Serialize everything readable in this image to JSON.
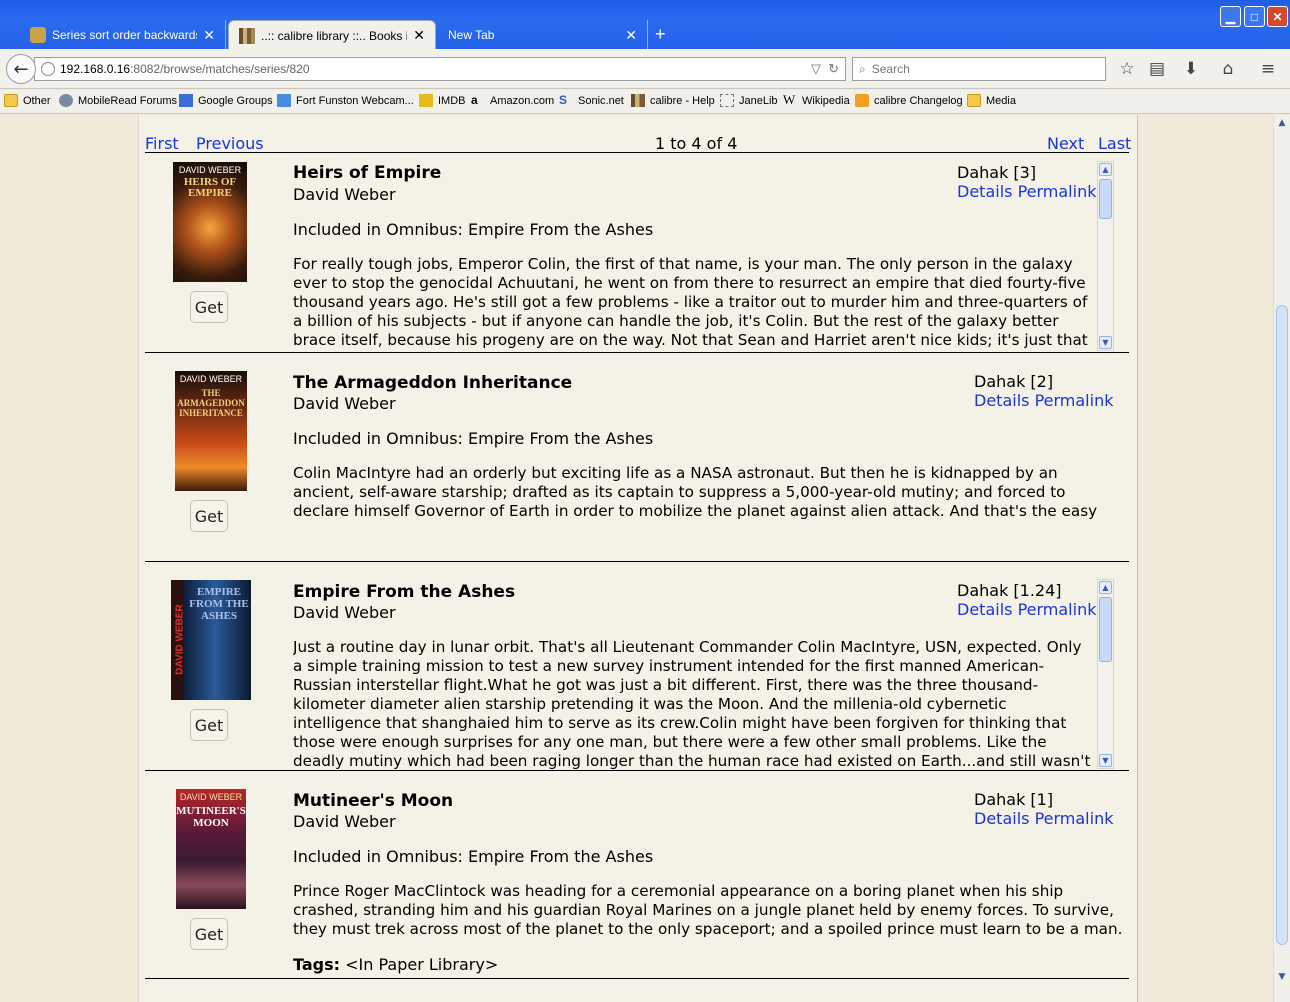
{
  "browser": {
    "tabs": [
      {
        "label": "Series sort order backwards v...",
        "active": false
      },
      {
        "label": "..:: calibre library ::.. Books i...",
        "active": true
      },
      {
        "label": "New Tab",
        "active": false
      }
    ],
    "new_tab_symbol": "+",
    "window_controls": {
      "minimize": "▁",
      "maximize": "□",
      "close": "✕"
    },
    "url_host": "192.168.0.16",
    "url_rest": ":8082/browse/matches/series/820",
    "search_placeholder": "Search",
    "toolbar_icons": [
      "back-icon",
      "reload-icon",
      "star-icon",
      "reading-list-icon",
      "download-icon",
      "home-icon",
      "menu-icon"
    ],
    "bookmarks": [
      {
        "label": "Other",
        "icon": "folder-icon"
      },
      {
        "label": "MobileRead Forums",
        "icon": "site-icon"
      },
      {
        "label": "Google Groups",
        "icon": "site-icon"
      },
      {
        "label": "Fort Funston Webcam...",
        "icon": "site-icon"
      },
      {
        "label": "IMDB",
        "icon": "imdb-icon"
      },
      {
        "label": "Amazon.com",
        "icon": "amazon-icon"
      },
      {
        "label": "Sonic.net",
        "icon": "site-icon"
      },
      {
        "label": "calibre - Help",
        "icon": "calibre-icon"
      },
      {
        "label": "JaneLib",
        "icon": "blank-icon"
      },
      {
        "label": "Wikipedia",
        "icon": "wikipedia-icon"
      },
      {
        "label": "calibre Changelog",
        "icon": "rss-icon"
      },
      {
        "label": "Media",
        "icon": "folder-icon"
      }
    ]
  },
  "pager": {
    "first": "First",
    "previous": "Previous",
    "range": "1 to 4 of 4",
    "next": "Next",
    "last": "Last"
  },
  "books": [
    {
      "title": "Heirs of Empire",
      "author": "David Weber",
      "omnibus": "Included in Omnibus: Empire From the Ashes",
      "series": "Dahak [3]",
      "details": "Details",
      "permalink": "Permalink",
      "get": "Get",
      "description": "For really tough jobs, Emperor Colin, the first of that name, is your man. The only person in the galaxy ever to stop the genocidal Achuutani, he went on from there to resurrect an empire that died fourty-five thousand years ago. He's still got a few problems - like a traitor out to murder him and three-quarters of a billion of his subjects - but if anyone can handle the job, it's Colin. But the rest of the galaxy better brace itself, because his progeny are on the way. Not that Sean and Harriet aren't nice kids; it's just that they've had a bad day.They're a long way from home, marooned with a",
      "cover": {
        "top_text": "DAVID WEBER",
        "title_text": "HEIRS OF EMPIRE"
      }
    },
    {
      "title": "The Armageddon Inheritance",
      "author": "David Weber",
      "omnibus": "Included in Omnibus: Empire From the Ashes",
      "series": "Dahak [2]",
      "details": "Details",
      "permalink": "Permalink",
      "get": "Get",
      "description": "Colin MacIntyre had an orderly but exciting life as a NASA astronaut. But then he is kidnapped by an ancient, self-aware starship; drafted as its captain to suppress a 5,000-year-old mutiny; and forced to declare himself Governor of Earth in order to mobilize the planet against alien attack. And that's the easy part. . . .",
      "cover": {
        "top_text": "DAVID WEBER",
        "title_text": "THE ARMAGEDDON INHERITANCE"
      }
    },
    {
      "title": "Empire From the Ashes",
      "author": "David Weber",
      "omnibus": "",
      "series": "Dahak [1.24]",
      "details": "Details",
      "permalink": "Permalink",
      "get": "Get",
      "description": "Just a routine day in lunar orbit. That's all Lieutenant Commander Colin MacIntyre, USN, expected. Only a simple training mission to test a new survey instrument intended for the first manned American-Russian interstellar flight.What he got was just a bit different. First, there was the three thousand-kilometer diameter alien starship pretending it was the Moon. And the millenia-old cybernetic intelligence that shanghaied him to serve as its crew.Colin might have been forgiven for thinking that those were enough surprises for any one man, but there were a few other small problems. Like the deadly mutiny which had been raging longer than the human race had existed on Earth...and still wasn't over. Or like the millions of other starships, crewed by genocidal aliens dedicated to the",
      "cover": {
        "top_text": "DAVID WEBER",
        "title_text": "EMPIRE FROM THE ASHES"
      }
    },
    {
      "title": "Mutineer's Moon",
      "author": "David Weber",
      "omnibus": "Included in Omnibus: Empire From the Ashes",
      "series": "Dahak [1]",
      "details": "Details",
      "permalink": "Permalink",
      "get": "Get",
      "description": "Prince Roger MacClintock was heading for a ceremonial appearance on a boring planet when his ship crashed, stranding him and his guardian Royal Marines on a jungle planet held by enemy forces. To survive, they must trek across most of the planet to the only spaceport; and a spoiled prince must learn to be a man. . . .",
      "tags_label": "Tags:",
      "tags_value": "<In Paper Library>",
      "cover": {
        "top_text": "DAVID WEBER",
        "title_text": "MUTINEER'S MOON"
      }
    }
  ]
}
